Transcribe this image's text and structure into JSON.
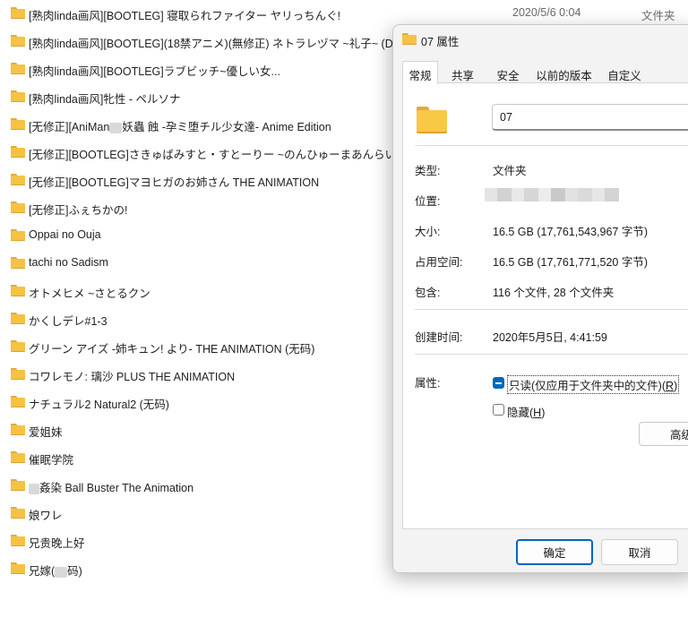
{
  "files": [
    {
      "name": "[熟肉linda画风][BOOTLEG] 寝取られファイター ヤリっちんぐ!",
      "date": "2020/5/6 0:04",
      "type": "文件夹"
    },
    {
      "name": "[熟肉linda画风][BOOTLEG](18禁アニメ)(無修正) ネトラレヅマ ~礼子~ (D"
    },
    {
      "name": "[熟肉linda画风][BOOTLEG]ラブビッチ~優しい女..."
    },
    {
      "name": "[熟肉linda画风]牝性 - ペルソナ"
    },
    {
      "name": "[无修正][AniMan",
      "name_after": "妖蟲 蝕 -孕ミ堕チル少女達- Anime Edition",
      "redacted": true
    },
    {
      "name": "[无修正][BOOTLEG]さきゅばみすと・すとーりー ~のんひゅーまあんらいぶ"
    },
    {
      "name": "[无修正][BOOTLEG]マヨヒガのお姉さん THE ANIMATION"
    },
    {
      "name": "[无修正]ふぇちかの!"
    },
    {
      "name": "Oppai no Ouja"
    },
    {
      "name": "tachi no Sadism"
    },
    {
      "name": "オトメヒメ ~さとるクン"
    },
    {
      "name": "かくしデレ#1-3"
    },
    {
      "name": "グリーン アイズ -姉キュン! より- THE ANIMATION (无码)"
    },
    {
      "name": "コワレモノ: 璃沙 PLUS THE ANIMATION"
    },
    {
      "name": "ナチュラル2 Natural2 (无码)"
    },
    {
      "name": "爱姐妹"
    },
    {
      "name": "催眠学院"
    },
    {
      "name": "",
      "name_after": "姦染 Ball Buster The Animation",
      "redacted_lead": true
    },
    {
      "name": "娘ワレ"
    },
    {
      "name": "兄贵晚上好"
    },
    {
      "name": "兄嫁(",
      "name_after": "码)",
      "redacted": true
    }
  ],
  "dialog": {
    "title": "07 属性",
    "tabs": [
      {
        "label": "常规",
        "active": true
      },
      {
        "label": "共享"
      },
      {
        "label": "安全"
      },
      {
        "label": "以前的版本"
      },
      {
        "label": "自定义"
      }
    ],
    "folder_name": "07",
    "props": {
      "type_label": "类型:",
      "type_value": "文件夹",
      "location_label": "位置:",
      "size_label": "大小:",
      "size_value": "16.5 GB (17,761,543,967 字节)",
      "disk_label": "占用空间:",
      "disk_value": "16.5 GB (17,761,771,520 字节)",
      "contains_label": "包含:",
      "contains_value": "116 个文件, 28 个文件夹",
      "created_label": "创建时间:",
      "created_value": "2020年5月5日, 4:41:59",
      "attr_label": "属性:"
    },
    "attrs": {
      "readonly_label": "只读(仅应用于文件夹中的文件)(",
      "readonly_key": "R",
      "hidden_label": "隐藏(",
      "hidden_key": "H",
      "close_paren": ")",
      "advanced_label": "高级"
    },
    "buttons": {
      "ok": "确定",
      "cancel": "取消"
    }
  },
  "colors": {
    "accent": "#0067c0",
    "folder": "#f6c243",
    "folder_tab": "#e5a93a"
  }
}
